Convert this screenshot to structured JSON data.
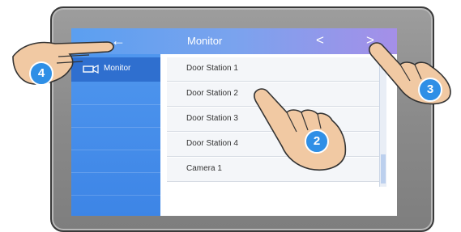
{
  "topbar": {
    "title": "Monitor",
    "back_icon": "←",
    "prev_icon": "<",
    "next_icon": ">"
  },
  "sidebar": {
    "items": [
      {
        "label": "Monitor",
        "icon": "camera-icon"
      }
    ]
  },
  "list": {
    "items": [
      "Door Station 1",
      "Door Station 2",
      "Door Station 3",
      "Door Station 4",
      "Camera 1"
    ]
  },
  "annotations": [
    {
      "label": "2"
    },
    {
      "label": "3"
    },
    {
      "label": "4"
    }
  ]
}
